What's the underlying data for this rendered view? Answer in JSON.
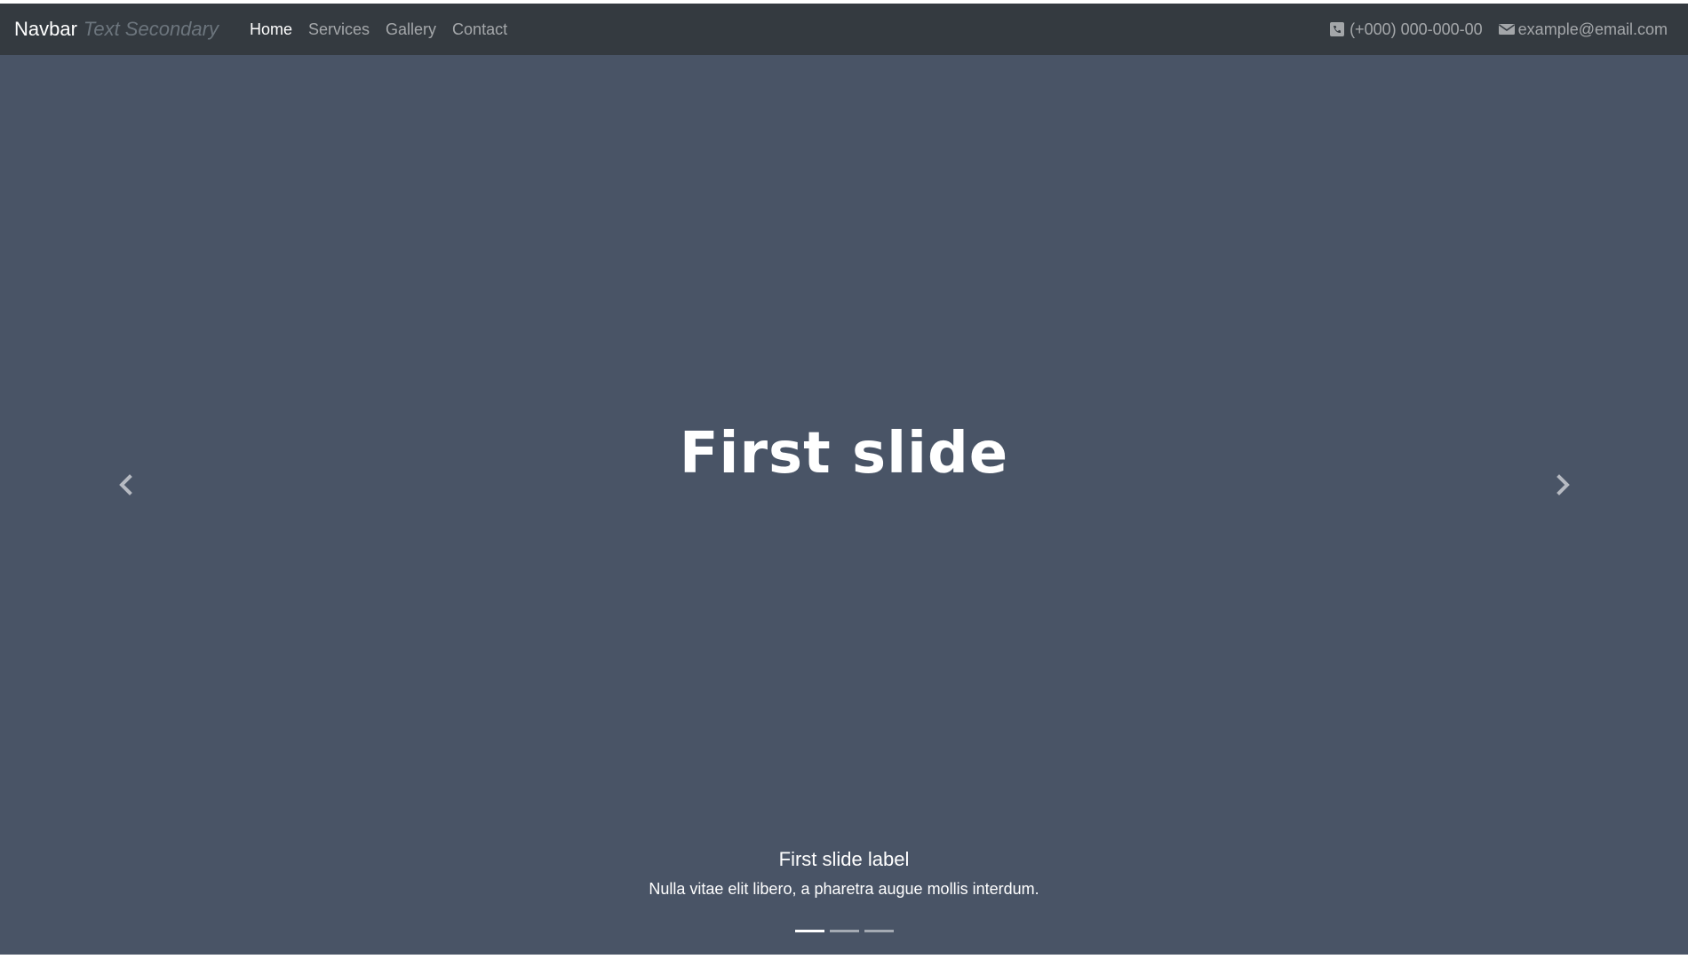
{
  "navbar": {
    "brand": "Navbar",
    "brand_secondary": "Text Secondary",
    "links": [
      {
        "label": "Home",
        "active": true
      },
      {
        "label": "Services",
        "active": false
      },
      {
        "label": "Gallery",
        "active": false
      },
      {
        "label": "Contact",
        "active": false
      }
    ],
    "phone": {
      "icon": "phone-icon",
      "text": "(+000) 000-000-00"
    },
    "email": {
      "icon": "envelope-icon",
      "text": "example@email.com"
    }
  },
  "carousel": {
    "slide_title": "First slide",
    "caption_title": "First slide label",
    "caption_text": "Nulla vitae elit libero, a pharetra augue mollis interdum.",
    "prev_icon": "chevron-left-icon",
    "next_icon": "chevron-right-icon",
    "indicator_count": 3,
    "active_indicator": 1,
    "background_color": "#495466"
  },
  "colors": {
    "navbar_bg": "#343a40",
    "muted_text": "#6c757d"
  }
}
